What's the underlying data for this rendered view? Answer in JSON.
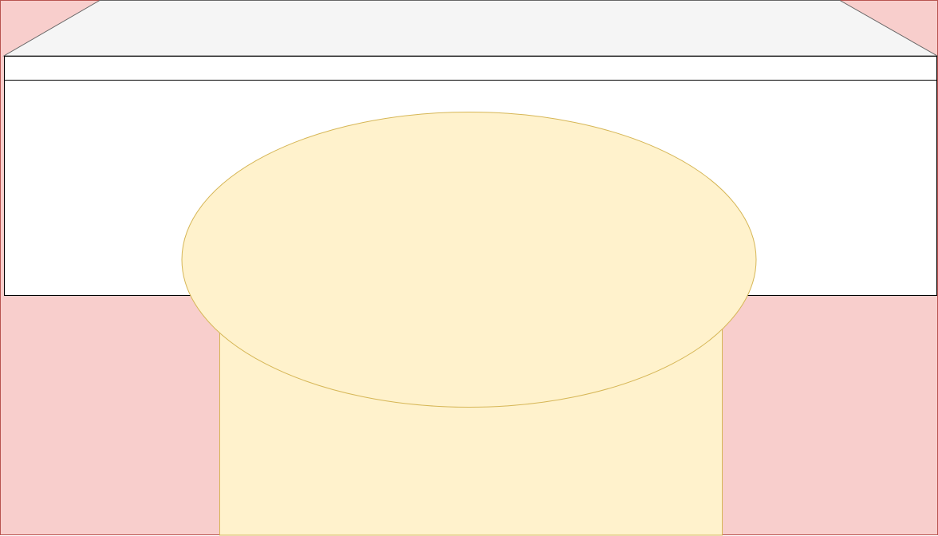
{
  "colors": {
    "background_fill": "#f8cecc",
    "background_stroke": "#b85450",
    "top_surface_fill": "#f5f5f5",
    "top_surface_stroke": "#666666",
    "panel_fill": "#ffffff",
    "panel_stroke": "#000000",
    "shape_fill": "#fff2cc",
    "shape_stroke": "#d6b656"
  },
  "shapes": [
    {
      "name": "background-block",
      "kind": "rectangle"
    },
    {
      "name": "top-surface",
      "kind": "trapezoid"
    },
    {
      "name": "header-strip",
      "kind": "rectangle"
    },
    {
      "name": "content-panel",
      "kind": "rectangle"
    },
    {
      "name": "stem-block",
      "kind": "rectangle"
    },
    {
      "name": "ellipse-shape",
      "kind": "ellipse"
    }
  ]
}
